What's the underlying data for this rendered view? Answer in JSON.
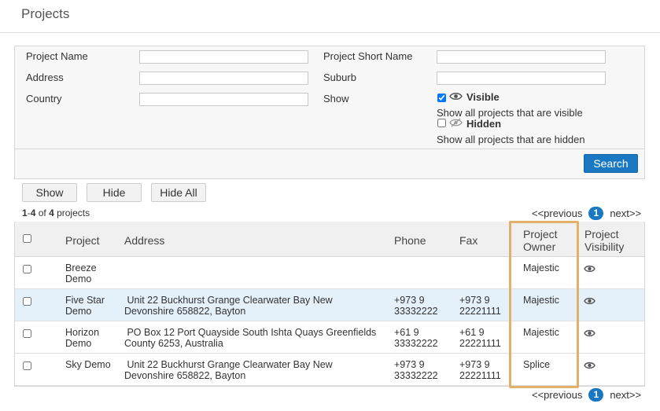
{
  "page": {
    "title": "Projects"
  },
  "filters": {
    "project_name_label": "Project Name",
    "project_name_value": "",
    "address_label": "Address",
    "address_value": "",
    "country_label": "Country",
    "country_value": "",
    "short_name_label": "Project Short Name",
    "short_name_value": "",
    "suburb_label": "Suburb",
    "suburb_value": "",
    "show_label": "Show",
    "visible_label": "Visible",
    "visible_checked": true,
    "visible_hint": "Show all projects that are visible",
    "hidden_label": "Hidden",
    "hidden_checked": false,
    "hidden_hint": "Show all projects that are hidden",
    "search_label": "Search"
  },
  "actions": {
    "show_label": "Show",
    "hide_label": "Hide",
    "hide_all_label": "Hide All"
  },
  "results": {
    "range_start": "1",
    "range_sep": "-",
    "range_end": "4",
    "of_text": " of ",
    "total": "4",
    "suffix": " projects"
  },
  "pager": {
    "previous": "<<previous",
    "current_page": "1",
    "next": "next>>"
  },
  "table": {
    "headers": {
      "project": "Project",
      "address": "Address",
      "phone": "Phone",
      "fax": "Fax",
      "owner_line1": "Project",
      "owner_line2": "Owner",
      "visibility_line1": "Project",
      "visibility_line2": "Visibility"
    },
    "rows": [
      {
        "project_l1": "Breeze",
        "project_l2": "Demo",
        "address_l1": "",
        "address_l2": "",
        "phone_l1": "",
        "phone_l2": "",
        "fax_l1": "",
        "fax_l2": "",
        "owner": "Majestic",
        "visibility_icon": "eye-icon"
      },
      {
        "project_l1": "Five Star",
        "project_l2": "Demo",
        "address_l1": " Unit 22 Buckhurst Grange Clearwater Bay New",
        "address_l2": "Devonshire 658822, Bayton",
        "phone_l1": "+973 9",
        "phone_l2": "33332222",
        "fax_l1": "+973 9",
        "fax_l2": "22221111",
        "owner": "Majestic",
        "visibility_icon": "eye-icon"
      },
      {
        "project_l1": "Horizon",
        "project_l2": "Demo",
        "address_l1": " PO Box 12 Port Quayside South Ishta Quays Greenfields",
        "address_l2": "County 6253, Australia",
        "phone_l1": "+61 9",
        "phone_l2": "33332222",
        "fax_l1": "+61 9",
        "fax_l2": "22221111",
        "owner": "Majestic",
        "visibility_icon": "eye-icon"
      },
      {
        "project_l1": "Sky Demo",
        "project_l2": "",
        "address_l1": " Unit 22 Buckhurst Grange Clearwater Bay New",
        "address_l2": "Devonshire 658822, Bayton",
        "phone_l1": "+973 9",
        "phone_l2": "33332222",
        "fax_l1": "+973 9",
        "fax_l2": "22221111",
        "owner": "Splice",
        "visibility_icon": "eye-icon"
      }
    ]
  },
  "colors": {
    "accent": "#1a78c2",
    "highlight_box": "#e2b06a",
    "selected_row": "#e4f0fa"
  }
}
